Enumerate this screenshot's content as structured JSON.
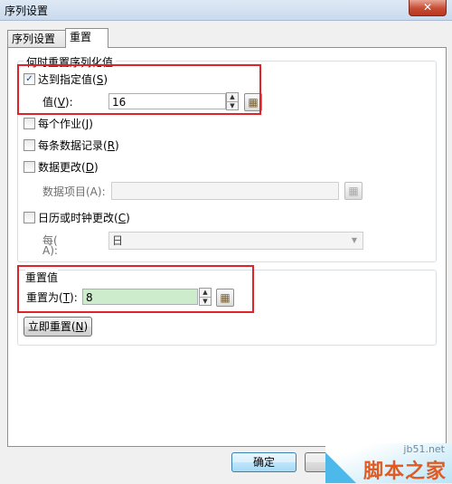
{
  "window": {
    "title": "序列设置",
    "close_glyph": "✕"
  },
  "tabs": [
    {
      "label": "序列设置"
    },
    {
      "label": "重置"
    }
  ],
  "reset_when": {
    "legend": "何时重置序列化值",
    "reach_value": {
      "label": "达到指定值",
      "shortcut": "S",
      "checked": true
    },
    "value": {
      "label": "值",
      "shortcut": "V",
      "value": "16"
    },
    "each_job": {
      "label": "每个作业",
      "shortcut": "J",
      "checked": false
    },
    "each_record": {
      "label": "每条数据记录",
      "shortcut": "R",
      "checked": false
    },
    "data_change": {
      "label": "数据更改",
      "shortcut": "D",
      "checked": false
    },
    "data_item": {
      "label": "数据项目(A):",
      "value": ""
    },
    "calendar_change": {
      "label": "日历或时钟更改",
      "shortcut": "C",
      "checked": false
    },
    "every": {
      "label_line1": "每(",
      "label_line2": "A):",
      "selected": "日"
    }
  },
  "reset_value": {
    "legend": "重置值",
    "reset_to": {
      "label": "重置为",
      "shortcut": "T",
      "value": "8"
    }
  },
  "reset_now_button": {
    "label": "立即重置",
    "shortcut": "N"
  },
  "footer": {
    "ok_label": "确定",
    "cancel_label": "取"
  },
  "watermark": {
    "url": "jb51.net",
    "text": "脚本之家"
  }
}
